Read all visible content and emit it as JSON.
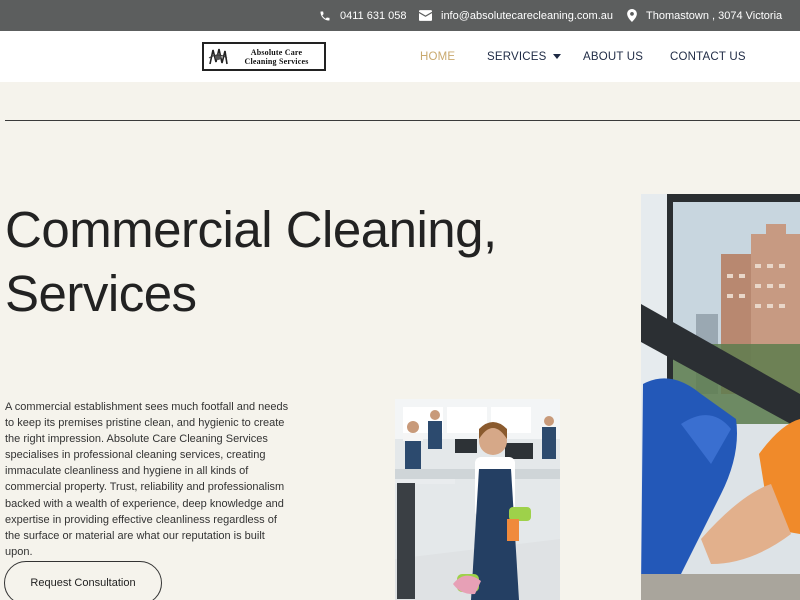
{
  "topbar": {
    "phone": "0411 631 058",
    "email": "info@absolutecarecleaning.com.au",
    "location": "Thomastown , 3074 Victoria",
    "icons": {
      "phone": "phone-icon",
      "email": "envelope-icon",
      "location": "map-pin-icon"
    }
  },
  "logo": {
    "line1": "Absolute Care",
    "line2": "Cleaning Services"
  },
  "nav": {
    "home": "HOME",
    "services": "SERVICES",
    "about": "ABOUT US",
    "contact": "CONTACT US",
    "active_color": "#c9a96e",
    "text_color": "#1e2a44"
  },
  "hero": {
    "title_line1": "Commercial Cleaning,",
    "title_line2": "Services",
    "body": "A commercial establishment sees much footfall and needs to keep its premises pristine clean, and hygienic to create the right impression. Absolute Care Cleaning Services specialises in professional cleaning services, creating immaculate cleanliness and hygiene in all kinds of commercial property. Trust, reliability and professionalism backed with a wealth of experience, deep knowledge and expertise in providing effective cleanliness regardless of the surface or material are what our reputation is built upon.",
    "cta": "Request Consultation"
  },
  "colors": {
    "topbar_bg": "#5c5e5e",
    "page_bg": "#f5f3ec",
    "accent": "#c9a96e"
  }
}
